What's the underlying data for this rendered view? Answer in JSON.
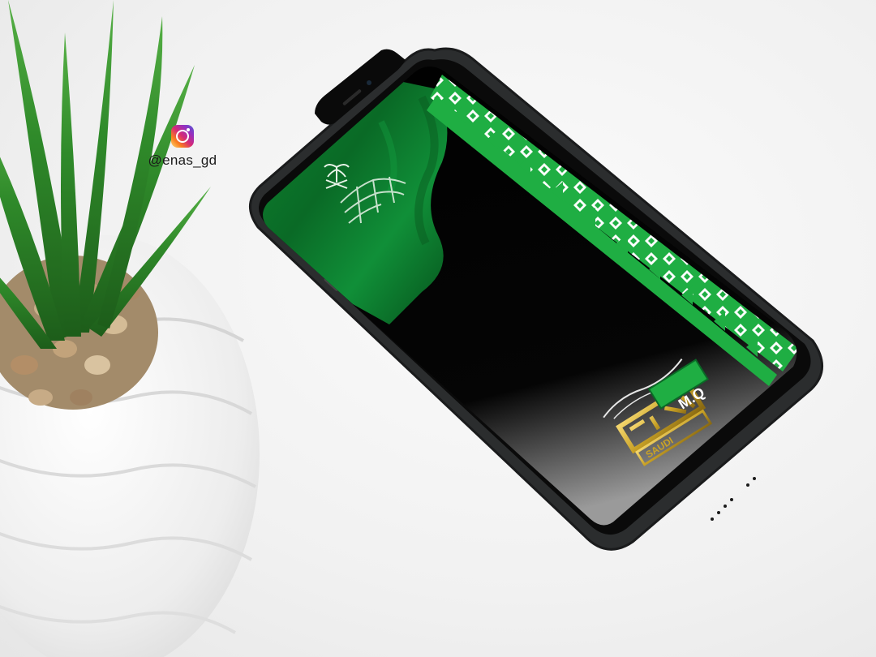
{
  "social": {
    "platform_icon": "instagram-icon",
    "handle": "@enas_gd"
  },
  "wallpaper": {
    "logo_text": "M.Q",
    "logo_subtitle": "SAUDI"
  },
  "colors": {
    "flag_green": "#0b7a2c",
    "pattern_green": "#1fae43",
    "screen_black": "#030303",
    "phone_body": "#2b2d2e",
    "logo_gold": "#c9a227",
    "background": "#f3f3f3"
  }
}
